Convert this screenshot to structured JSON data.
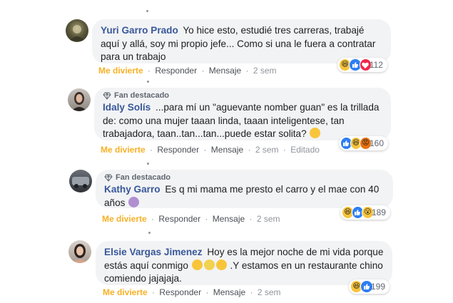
{
  "actions": {
    "like": "Me divierte",
    "reply": "Responder",
    "message": "Mensaje",
    "separator": "·"
  },
  "comments": [
    {
      "author": "Yuri Garro Prado",
      "text": "Yo hice esto, estudié tres carreras, trabajé aquí y allá, soy mi propio jefe... Como si una le fuera a contratar para un trabajo",
      "time": "2 sem",
      "edited": "",
      "badge": "",
      "reactions": [
        "haha",
        "like",
        "love"
      ],
      "reaction_count": "112"
    },
    {
      "author": "Idaly Solís",
      "text": "...para mí un \"aguevante nomber guan\" es la trillada de: como una mujer taaan linda, taaan inteligentese, tan trabajadora, taan..tan...tan...puede estar solita?",
      "time": "2 sem",
      "edited": "Editado",
      "badge": "Fan destacado",
      "reactions": [
        "like",
        "haha",
        "angry"
      ],
      "reaction_count": "160"
    },
    {
      "author": "Kathy Garro",
      "text": "Es q mi mama me presto el carro y el mae con 40 años",
      "time": "2 sem",
      "edited": "",
      "badge": "Fan destacado",
      "reactions": [
        "haha",
        "like",
        "wow"
      ],
      "reaction_count": "189"
    },
    {
      "author": "Elsie Vargas Jimenez",
      "text_part1": "Hoy es la mejor noche de mi vida porque estás aquí conmigo",
      "text_part2": " .Y estamos en un restaurante chino comiendo jajajaja.",
      "time": "2 sem",
      "edited": "",
      "badge": "",
      "reactions": [
        "haha",
        "like"
      ],
      "reaction_count": "199"
    }
  ],
  "colors": {
    "author": "#385898",
    "like_action": "#f7b125",
    "bubble": "#f2f3f5"
  }
}
